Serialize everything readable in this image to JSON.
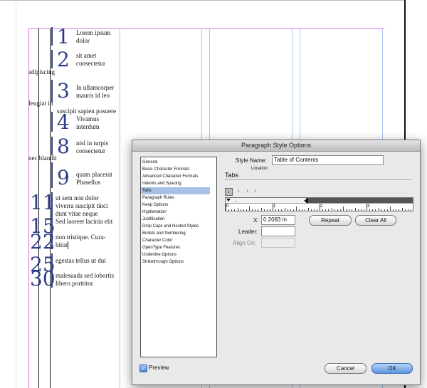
{
  "document": {
    "entries": [
      {
        "num": "1",
        "lines": [
          "Lorem ipsum",
          "dolor"
        ]
      },
      {
        "num": "2",
        "lines": [
          "sit amet",
          "consectetur"
        ]
      },
      {
        "num": "3",
        "lines": [
          "In ullamcorper",
          "mauris id leo"
        ]
      },
      {
        "num": "4",
        "lines": [
          "Vivamus",
          "interdum"
        ]
      },
      {
        "num": "8",
        "lines": [
          "nisl in turpis",
          "consectetur"
        ]
      },
      {
        "num": "9",
        "lines": [
          "quam placerat",
          "Phasellus"
        ]
      },
      {
        "num": "11",
        "lines": [
          "ut sem non dolor",
          "viverra suscipit tinci",
          "dunt vitae neque"
        ]
      },
      {
        "num": "15",
        "lines": [
          "Sed laoreet lacinia elit"
        ]
      },
      {
        "num": "22",
        "lines": [
          "non tristique. Cura-",
          "bitur"
        ]
      },
      {
        "num": "25",
        "lines": [
          "egestas tellus ut dui"
        ]
      },
      {
        "num": "30",
        "lines": [
          "malesuada sed lobortis",
          "libero porttitor"
        ]
      }
    ],
    "overflow_words": [
      "adipiscing",
      "feugiat in",
      "suscipit sapien posuere",
      "nec blandit"
    ]
  },
  "dialog": {
    "title": "Paragraph Style Options",
    "categories": [
      "General",
      "Basic Character Formats",
      "Advanced Character Formats",
      "Indents and Spacing",
      "Tabs",
      "Paragraph Rules",
      "Keep Options",
      "Hyphenation",
      "Justification",
      "Drop Caps and Nested Styles",
      "Bullets and Numbering",
      "Character Color",
      "OpenType Features",
      "Underline Options",
      "Strikethrough Options"
    ],
    "selected_category": "Tabs",
    "style_name_label": "Style Name:",
    "style_name_value": "Table of Contents",
    "location_label": "Location:",
    "section_title": "Tabs",
    "tab_types": [
      "left-tab-icon",
      "center-tab-icon",
      "right-tab-icon",
      "decimal-tab-icon"
    ],
    "ruler_numbers": [
      "0",
      "1",
      "2",
      "3"
    ],
    "x_label": "X:",
    "x_value": "0.2083 in",
    "leader_label": "Leader:",
    "leader_value": "",
    "align_on_label": "Align On:",
    "align_on_value": "",
    "repeat_label": "Repeat",
    "clear_all_label": "Clear All",
    "preview_label": "Preview",
    "preview_checked": true,
    "cancel_label": "Cancel",
    "ok_label": "OK",
    "colors": {
      "accent": "#5b95e0",
      "selection": "#a8c1e6",
      "numbers": "#2c3e86"
    }
  }
}
